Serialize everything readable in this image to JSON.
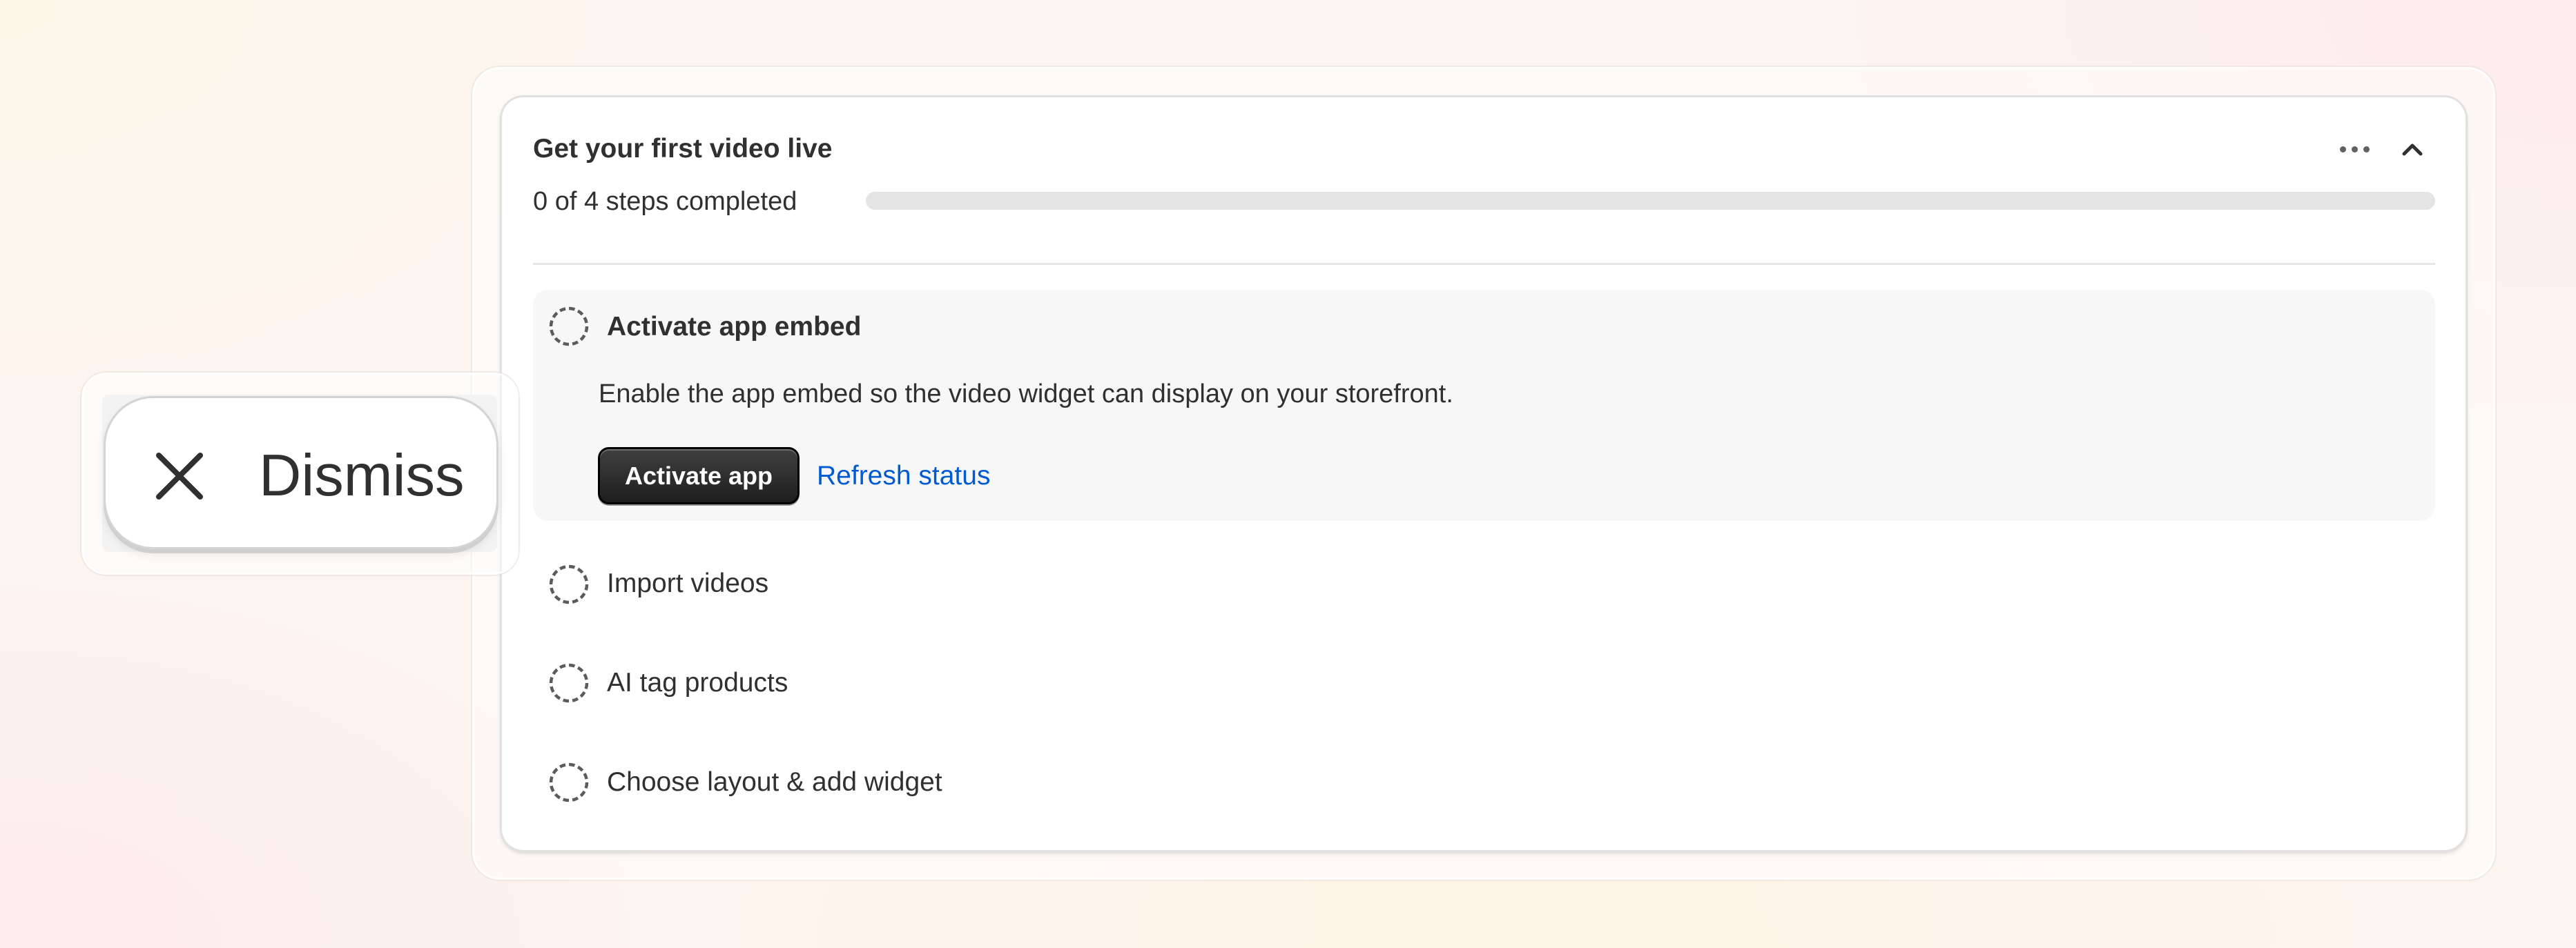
{
  "card": {
    "title": "Get your first video live",
    "progress_label": "0 of 4 steps completed",
    "progress_fraction": 0
  },
  "steps": [
    {
      "title": "Activate app embed",
      "description": "Enable the app embed so the video widget can display on your storefront.",
      "primary_action": "Activate app",
      "secondary_action": "Refresh status",
      "completed": false
    },
    {
      "title": "Import videos",
      "completed": false
    },
    {
      "title": "AI tag products",
      "completed": false
    },
    {
      "title": "Choose layout & add widget",
      "completed": false
    }
  ],
  "dismiss": {
    "label": "Dismiss"
  },
  "icons": {
    "more": "ellipsis-icon",
    "collapse": "chevron-up-icon",
    "step_status": "dashed-circle-icon",
    "dismiss": "close-icon"
  },
  "colors": {
    "link": "#005bd3",
    "primary_button": "#303030",
    "progress_track": "#e4e4e4"
  }
}
